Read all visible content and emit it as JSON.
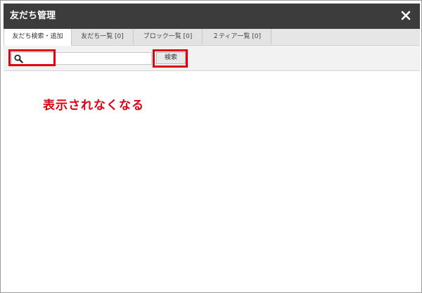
{
  "window": {
    "title": "友だち管理",
    "close_icon": "close-icon"
  },
  "tabs": [
    {
      "label": "友だち検索・追加",
      "active": true
    },
    {
      "label": "友だち一覧 [0]",
      "active": false
    },
    {
      "label": "ブロック一覧 [0]",
      "active": false
    },
    {
      "label": "２ティア一覧 [0]",
      "active": false
    }
  ],
  "search": {
    "icon": "search-icon",
    "value": "",
    "button_label": "検索"
  },
  "annotation": {
    "text": "表示されなくなる",
    "color": "#e00012"
  }
}
